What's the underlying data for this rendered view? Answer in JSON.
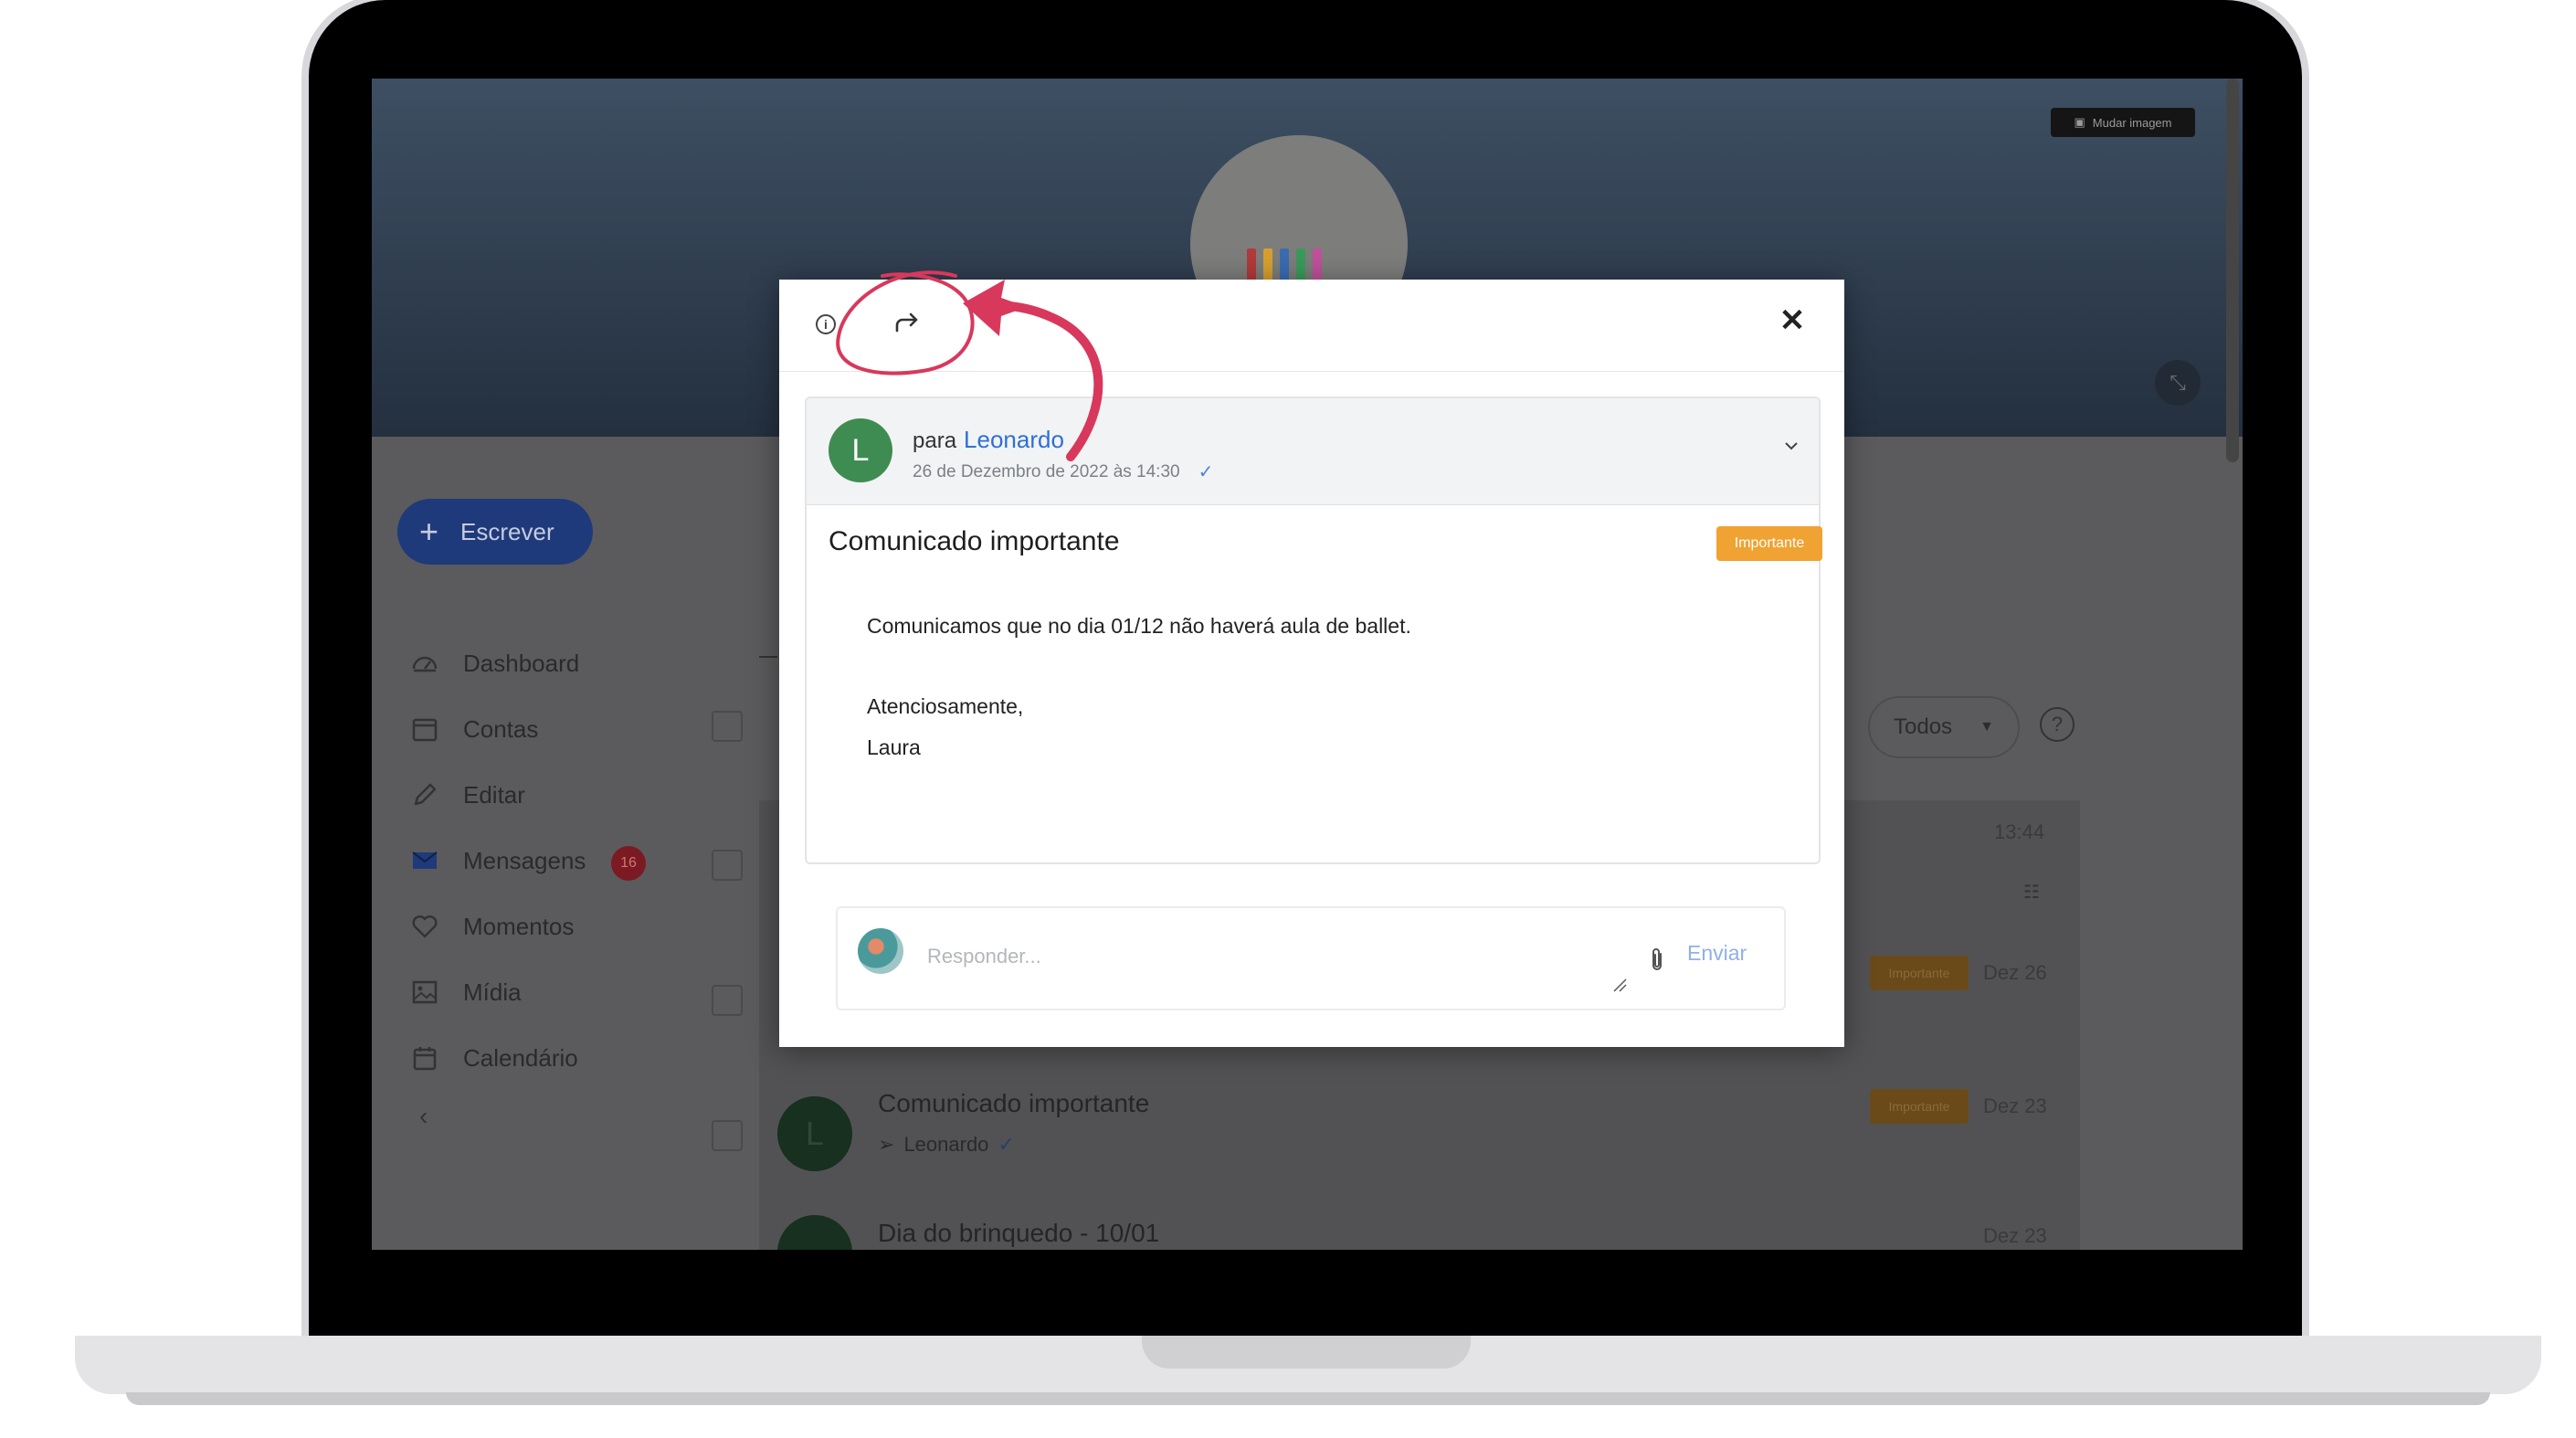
{
  "background": {
    "change_image_label": "Mudar imagem",
    "compose_label": "Escrever",
    "nav": [
      {
        "label": "Dashboard",
        "icon": "dashboard-icon"
      },
      {
        "label": "Contas",
        "icon": "accounts-icon"
      },
      {
        "label": "Editar",
        "icon": "pencil-icon"
      },
      {
        "label": "Mensagens",
        "icon": "mail-icon",
        "badge": "16"
      },
      {
        "label": "Momentos",
        "icon": "heart-icon"
      },
      {
        "label": "Mídia",
        "icon": "image-icon"
      },
      {
        "label": "Calendário",
        "icon": "calendar-icon"
      }
    ],
    "collapse_icon": "chevron-left-icon",
    "filter": {
      "value": "Todos"
    },
    "rows": [
      {
        "time": "13:44"
      },
      {
        "tag": "Importante",
        "date": "Dez 26"
      },
      {
        "avatar": "L",
        "title": "Comunicado importante",
        "recipient": "Leonardo",
        "tag": "Importante",
        "date": "Dez 23"
      },
      {
        "title": "Dia do brinquedo - 10/01",
        "date": "Dez 23"
      }
    ]
  },
  "modal": {
    "toolbar": {
      "info_icon": "info-icon",
      "forward_icon": "forward-icon",
      "close_icon": "close-icon"
    },
    "message": {
      "avatar_letter": "L",
      "to_prefix": "para",
      "recipient": "Leonardo",
      "date": "26 de Dezembro de 2022 às 14:30",
      "subject": "Comunicado importante",
      "tag": "Importante",
      "body": [
        "Comunicamos que no dia 01/12 não haverá aula de ballet.",
        "Atenciosamente,",
        "Laura"
      ]
    },
    "reply": {
      "placeholder": "Responder...",
      "send_label": "Enviar"
    }
  },
  "colors": {
    "accent_blue": "#2f6fd6",
    "important_orange": "#f0a232",
    "avatar_green": "#3f8c52",
    "annotation_red": "#d8385c"
  }
}
